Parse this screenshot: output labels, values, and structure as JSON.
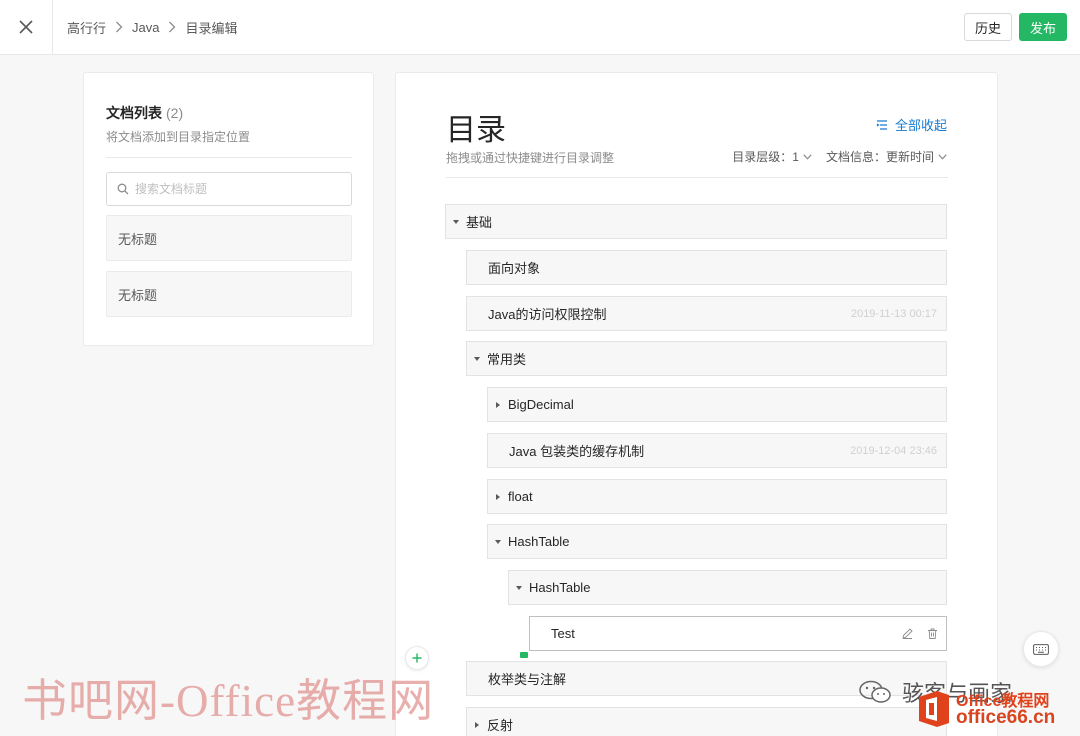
{
  "topbar": {
    "breadcrumb": [
      "高行行",
      "Java",
      "目录编辑"
    ],
    "history_label": "历史",
    "publish_label": "发布"
  },
  "left_panel": {
    "title": "文档列表",
    "count": "(2)",
    "subtitle": "将文档添加到目录指定位置",
    "search_placeholder": "搜索文档标题",
    "docs": [
      "无标题",
      "无标题"
    ]
  },
  "right_panel": {
    "title": "目录",
    "subtitle": "拖拽或通过快捷键进行目录调整",
    "collapse_all_label": "全部收起",
    "level_label": "目录层级：",
    "level_value": "1",
    "doc_info_label": "文档信息：",
    "doc_info_value": "更新时间",
    "tree": [
      {
        "label": "基础",
        "caret": "down",
        "date": ""
      },
      {
        "label": "面向对象",
        "caret": "none",
        "date": ""
      },
      {
        "label": "Java的访问权限控制",
        "caret": "none",
        "date": "2019-11-13 00:17"
      },
      {
        "label": "常用类",
        "caret": "down",
        "date": ""
      },
      {
        "label": "BigDecimal",
        "caret": "right",
        "date": ""
      },
      {
        "label": "Java 包装类的缓存机制",
        "caret": "none",
        "date": "2019-12-04 23:46"
      },
      {
        "label": "float",
        "caret": "right",
        "date": ""
      },
      {
        "label": "HashTable",
        "caret": "down",
        "date": ""
      },
      {
        "label": "HashTable",
        "caret": "down",
        "date": ""
      },
      {
        "label": "Test",
        "caret": "none",
        "date": ""
      },
      {
        "label": "枚举类与注解",
        "caret": "none",
        "date": ""
      },
      {
        "label": "反射",
        "caret": "right",
        "date": ""
      }
    ]
  },
  "watermarks": {
    "site_text": "书吧网-Office教程网",
    "weixin_text": "骇客与画家",
    "office_top": "Office教程网",
    "office_bottom": "office66.cn"
  },
  "colors": {
    "accent_green": "#25b864",
    "link_blue": "#1a7bd1",
    "watermark_red": "#e0431c"
  },
  "icons": [
    "close-icon",
    "chevron-right-icon",
    "search-icon",
    "collapse-list-icon",
    "chevron-down-icon",
    "caret-down-icon",
    "caret-right-icon",
    "edit-icon",
    "trash-icon",
    "plus-icon",
    "keyboard-icon",
    "wechat-icon",
    "office-logo-icon"
  ]
}
